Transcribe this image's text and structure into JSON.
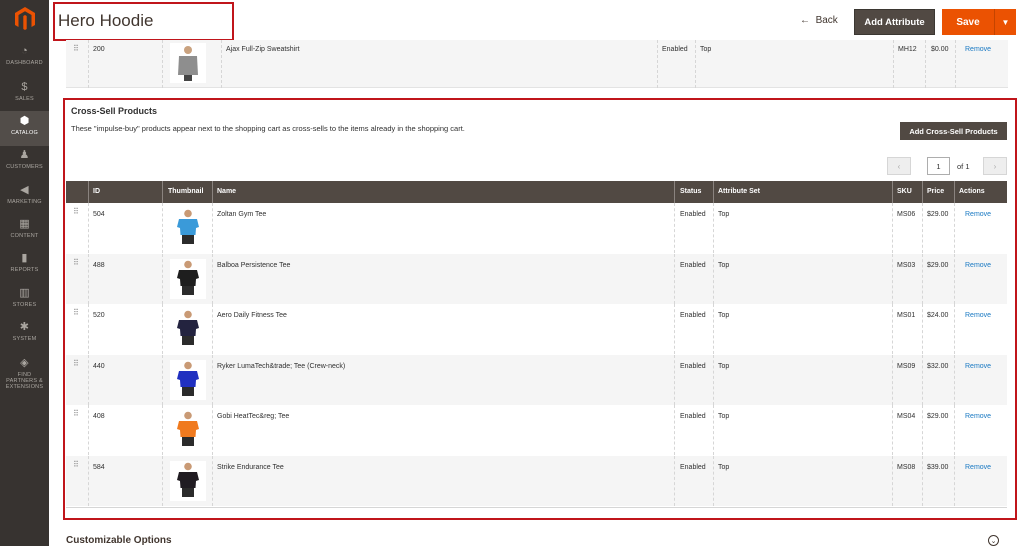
{
  "sidebar": {
    "items": [
      {
        "label": "DASHBOARD",
        "icon": "dashboard-icon",
        "glyph": "◔"
      },
      {
        "label": "SALES",
        "icon": "dollar-icon",
        "glyph": "$"
      },
      {
        "label": "CATALOG",
        "icon": "cube-icon",
        "glyph": "⬢"
      },
      {
        "label": "CUSTOMERS",
        "icon": "person-icon",
        "glyph": "♟"
      },
      {
        "label": "MARKETING",
        "icon": "megaphone-icon",
        "glyph": "◀"
      },
      {
        "label": "CONTENT",
        "icon": "layout-icon",
        "glyph": "▦"
      },
      {
        "label": "REPORTS",
        "icon": "bar-chart-icon",
        "glyph": "▮"
      },
      {
        "label": "STORES",
        "icon": "store-icon",
        "glyph": "▥"
      },
      {
        "label": "SYSTEM",
        "icon": "gear-icon",
        "glyph": "✱"
      },
      {
        "label": "FIND PARTNERS & EXTENSIONS",
        "icon": "extensions-icon",
        "glyph": "◈"
      }
    ],
    "active": "CATALOG",
    "colors": {
      "bg": "#373330",
      "active_bg": "#524d49",
      "logo": "#eb5202"
    }
  },
  "header": {
    "title": "Hero Hoodie",
    "back_label": "Back",
    "back_arrow": "←",
    "add_attribute_label": "Add Attribute",
    "save_label": "Save",
    "save_arrow": "▼"
  },
  "prev_row": {
    "id": "200",
    "name": "Ajax Full-Zip Sweatshirt",
    "status": "Enabled",
    "attribute_set": "Top",
    "sku": "MH12",
    "price": "$0.00",
    "action": "Remove",
    "shirt_color": "#8e8e8e"
  },
  "cross_sell": {
    "title": "Cross-Sell Products",
    "description": "These \"impulse-buy\" products appear next to the shopping cart as cross-sells to the items already in the shopping cart.",
    "add_button": "Add Cross-Sell Products",
    "pager": {
      "prev": "‹",
      "page": "1",
      "of_label": "of 1",
      "next": "›"
    },
    "columns": [
      "ID",
      "Thumbnail",
      "Name",
      "Status",
      "Attribute Set",
      "SKU",
      "Price",
      "Actions"
    ],
    "rows": [
      {
        "id": "504",
        "name": "Zoltan Gym Tee",
        "status": "Enabled",
        "attribute_set": "Top",
        "sku": "MS06",
        "price": "$29.00",
        "action": "Remove",
        "shirt_color": "#3a9ad9"
      },
      {
        "id": "488",
        "name": "Balboa Persistence Tee",
        "status": "Enabled",
        "attribute_set": "Top",
        "sku": "MS03",
        "price": "$29.00",
        "action": "Remove",
        "shirt_color": "#1e1e1e"
      },
      {
        "id": "520",
        "name": "Aero Daily Fitness Tee",
        "status": "Enabled",
        "attribute_set": "Top",
        "sku": "MS01",
        "price": "$24.00",
        "action": "Remove",
        "shirt_color": "#23233f"
      },
      {
        "id": "440",
        "name": "Ryker LumaTech&trade; Tee (Crew-neck)",
        "status": "Enabled",
        "attribute_set": "Top",
        "sku": "MS09",
        "price": "$32.00",
        "action": "Remove",
        "shirt_color": "#2030c0"
      },
      {
        "id": "408",
        "name": "Gobi HeatTec&reg; Tee",
        "status": "Enabled",
        "attribute_set": "Top",
        "sku": "MS04",
        "price": "$29.00",
        "action": "Remove",
        "shirt_color": "#f07a1e"
      },
      {
        "id": "584",
        "name": "Strike Endurance Tee",
        "status": "Enabled",
        "attribute_set": "Top",
        "sku": "MS08",
        "price": "$39.00",
        "action": "Remove",
        "shirt_color": "#201c22"
      }
    ]
  },
  "customizable": {
    "title": "Customizable Options",
    "toggle": "⌄"
  }
}
